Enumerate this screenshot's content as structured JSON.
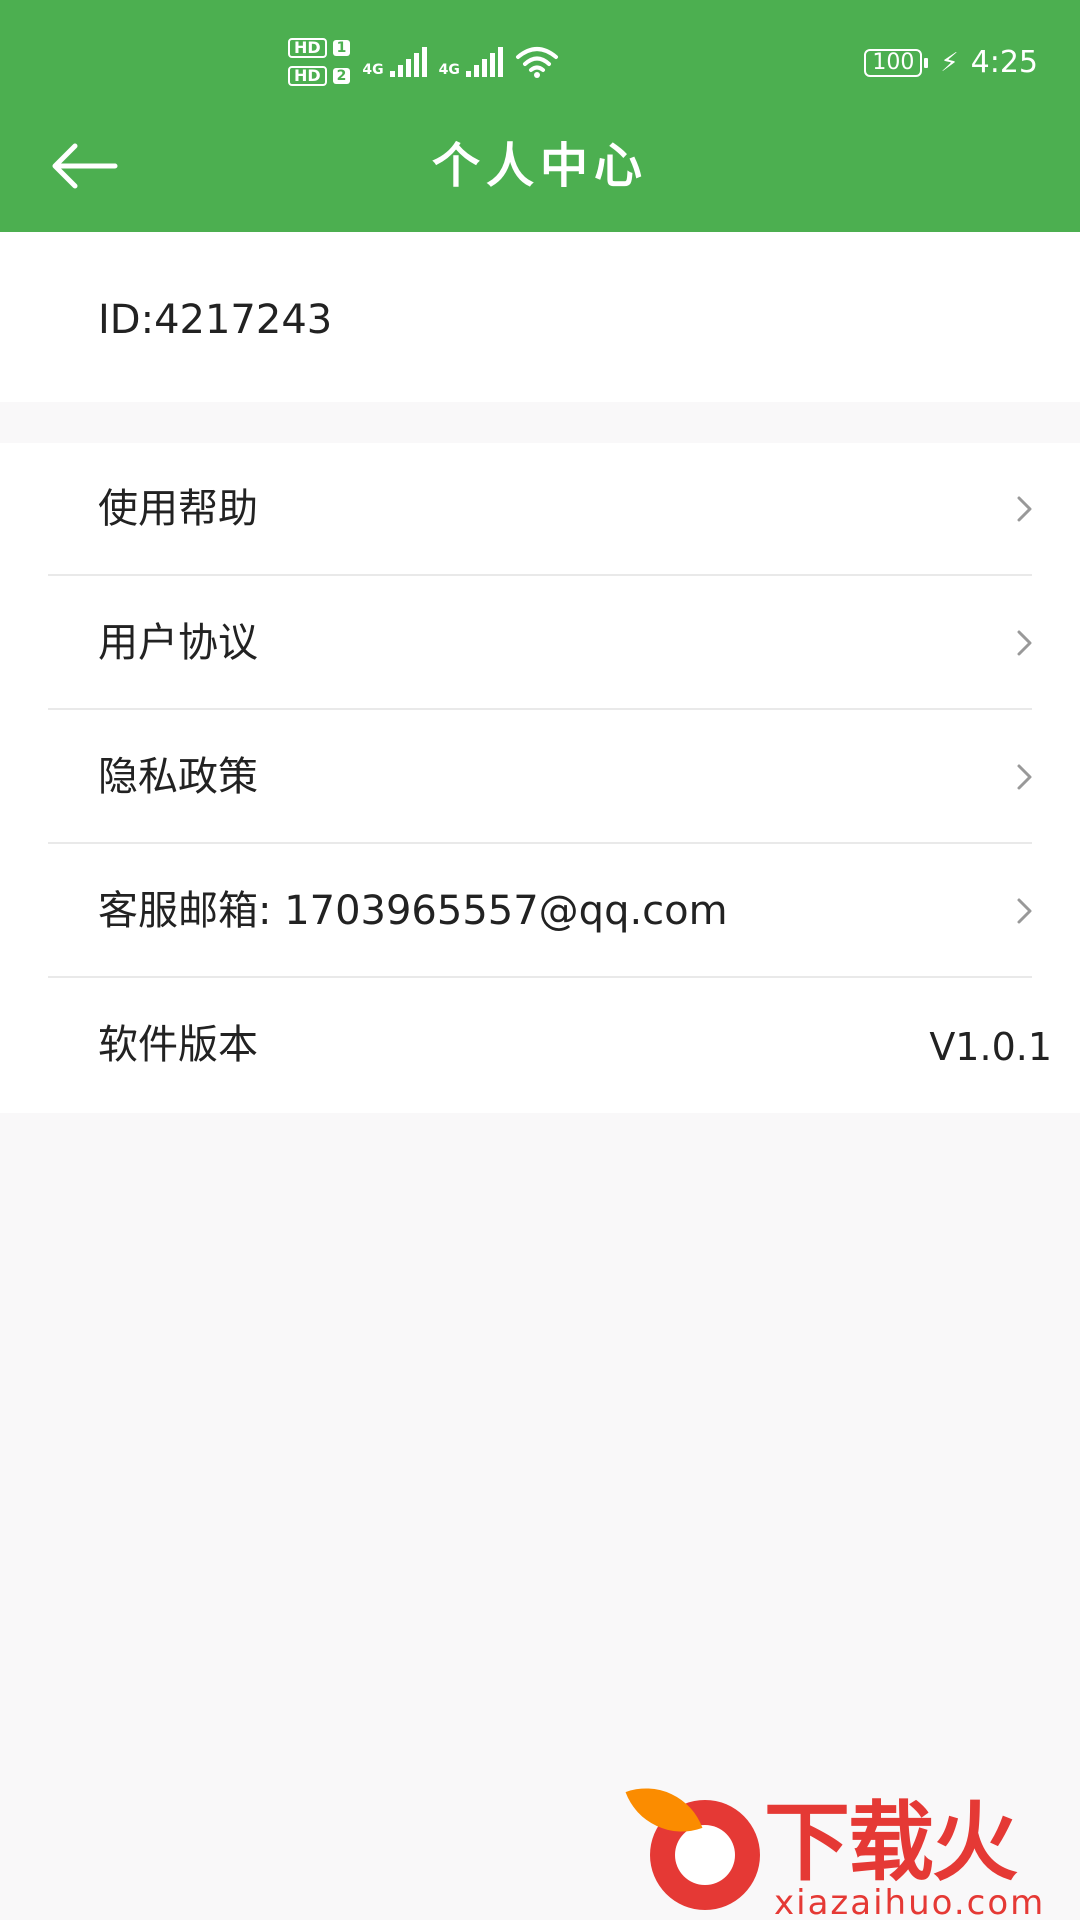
{
  "status_bar": {
    "hd1": "HD",
    "sim1": "1",
    "hd2": "HD",
    "sim2": "2",
    "net1": "4G",
    "net2": "4G",
    "battery": "100",
    "time": "4:25"
  },
  "header": {
    "title": "个人中心",
    "back_icon": "arrow-left-icon",
    "color": "#4caf50"
  },
  "profile": {
    "id_text": "ID:4217243"
  },
  "menu": {
    "items": [
      {
        "label": "使用帮助"
      },
      {
        "label": "用户协议"
      },
      {
        "label": "隐私政策"
      },
      {
        "label": "客服邮箱: 1703965557@qq.com"
      }
    ],
    "version_label": "软件版本",
    "version_value": "V1.0.1"
  },
  "watermark": {
    "brand": "下载火",
    "site": "xiazaihuo.com"
  }
}
